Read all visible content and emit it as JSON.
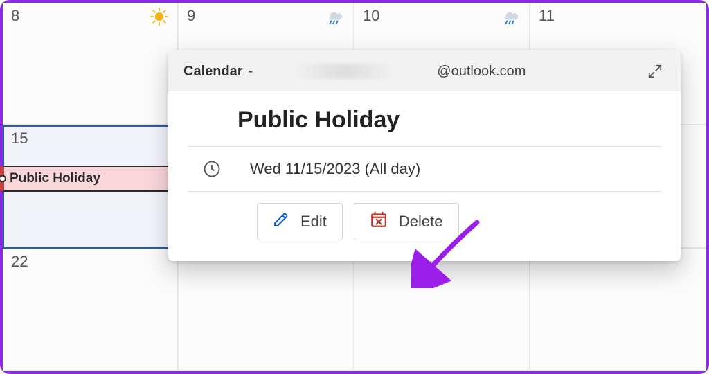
{
  "days": {
    "r0c0": "8",
    "r0c1": "9",
    "r0c2": "10",
    "r0c3": "11",
    "r1c0": "15",
    "r2c0": "22"
  },
  "event_pill": {
    "title": "Public Holiday"
  },
  "popup": {
    "calendar_label": "Calendar",
    "dash": " - ",
    "email_suffix": "@outlook.com",
    "event_title": "Public Holiday",
    "time_text": "Wed 11/15/2023 (All day)",
    "edit_label": "Edit",
    "delete_label": "Delete"
  }
}
